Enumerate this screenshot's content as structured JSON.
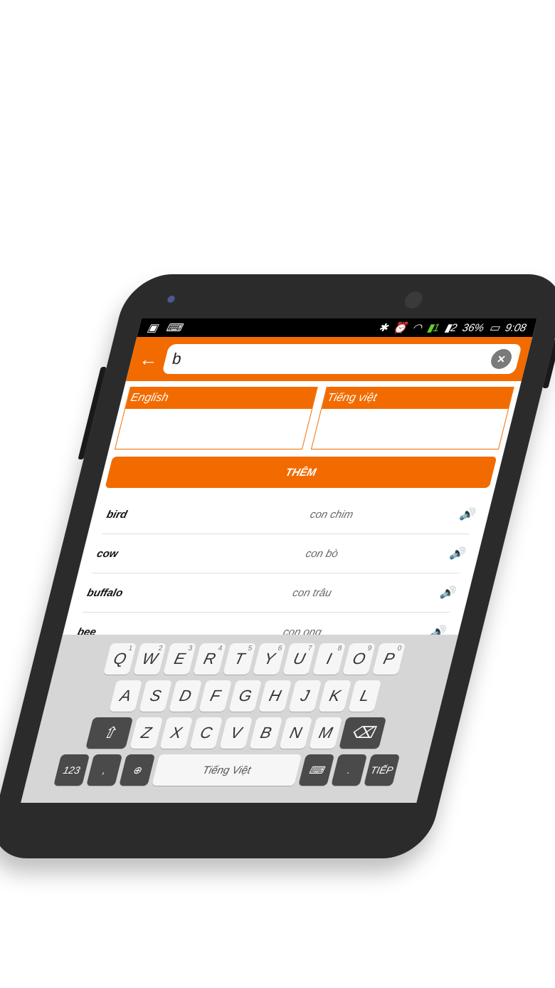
{
  "status": {
    "battery": "36%",
    "time": "9:08",
    "sim1": "1",
    "sim2": "2"
  },
  "search": {
    "value": "b"
  },
  "fields": {
    "english_label": "English",
    "vietnamese_label": "Tiếng việt"
  },
  "add_button_label": "THÊM",
  "words": [
    {
      "en": "bird",
      "vi": "con chim"
    },
    {
      "en": "cow",
      "vi": "con bò"
    },
    {
      "en": "buffalo",
      "vi": "con trâu"
    },
    {
      "en": "bee",
      "vi": "con ong"
    }
  ],
  "keyboard": {
    "row1": [
      "Q",
      "W",
      "E",
      "R",
      "T",
      "Y",
      "U",
      "I",
      "O",
      "P"
    ],
    "row1_nums": [
      "1",
      "2",
      "3",
      "4",
      "5",
      "6",
      "7",
      "8",
      "9",
      "0"
    ],
    "row2": [
      "A",
      "S",
      "D",
      "F",
      "G",
      "H",
      "J",
      "K",
      "L"
    ],
    "row3": [
      "Z",
      "X",
      "C",
      "V",
      "B",
      "N",
      "M"
    ],
    "symbols_key": "123",
    "comma_key": ",",
    "space_label": "Tiếng Việt",
    "period_key": ".",
    "next_key": "TIẾP"
  },
  "colors": {
    "accent": "#f26b00",
    "speaker": "#2aa84a"
  }
}
